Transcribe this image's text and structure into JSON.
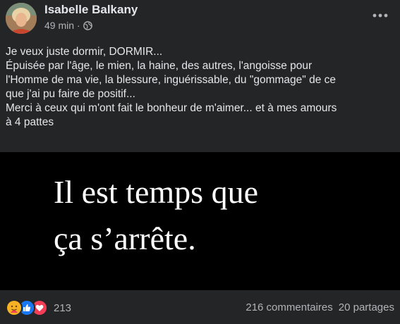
{
  "post": {
    "author": "Isabelle Balkany",
    "time": "49 min",
    "separator": "·",
    "privacy_icon": "globe-icon",
    "more_icon": "more-icon",
    "text_lines": [
      "Je veux juste dormir, DORMIR...",
      "Épuisée par l'âge, le mien, la haine, des autres, l'angoisse pour",
      "l'Homme de ma vie, la blessure,  inguérissable, du \"gommage\" de ce",
      "que j'ai pu faire de positif...",
      "Merci à ceux qui m'ont fait le bonheur de m'aimer... et à mes amours",
      "à 4 pattes"
    ],
    "image_text": [
      "Il est temps que",
      "ça s’arrête."
    ]
  },
  "footer": {
    "reaction_icons": [
      "care-icon",
      "like-icon",
      "love-icon"
    ],
    "reaction_count": "213",
    "comments": "216 commentaires",
    "shares": "20 partages"
  },
  "colors": {
    "background": "#242526",
    "text": "#e4e6eb",
    "secondary": "#b0b3b8",
    "like_blue": "#1877f2",
    "love_red": "#f33e58",
    "care_yellow": "#f7b125"
  }
}
